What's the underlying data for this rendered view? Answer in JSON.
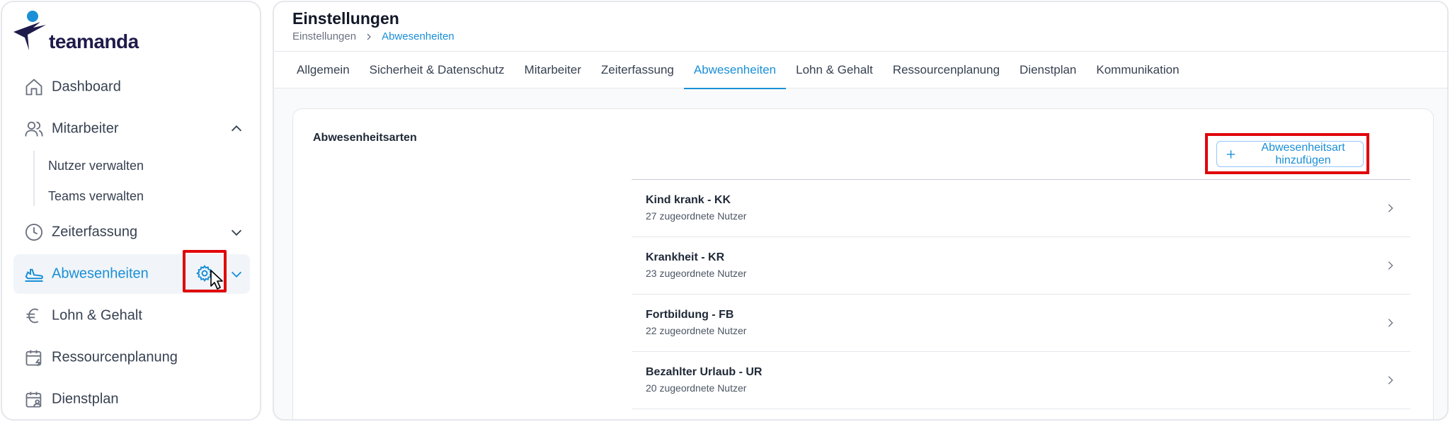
{
  "brand": {
    "name": "teamanda"
  },
  "sidebar": {
    "items": [
      {
        "label": "Dashboard",
        "icon": "home-icon"
      },
      {
        "label": "Mitarbeiter",
        "icon": "users-icon",
        "expanded": true
      },
      {
        "label": "Zeiterfassung",
        "icon": "clock-icon",
        "expanded": false
      },
      {
        "label": "Abwesenheiten",
        "icon": "plane-icon",
        "active": true
      },
      {
        "label": "Lohn & Gehalt",
        "icon": "euro-icon"
      },
      {
        "label": "Ressourcenplanung",
        "icon": "calendar-icon"
      },
      {
        "label": "Dienstplan",
        "icon": "calendar-user-icon"
      }
    ],
    "sub_items": [
      "Nutzer verwalten",
      "Teams verwalten"
    ]
  },
  "header": {
    "title": "Einstellungen",
    "breadcrumb": [
      "Einstellungen",
      "Abwesenheiten"
    ]
  },
  "tabs": [
    {
      "label": "Allgemein"
    },
    {
      "label": "Sicherheit & Datenschutz"
    },
    {
      "label": "Mitarbeiter"
    },
    {
      "label": "Zeiterfassung"
    },
    {
      "label": "Abwesenheiten",
      "active": true
    },
    {
      "label": "Lohn & Gehalt"
    },
    {
      "label": "Ressourcenplanung"
    },
    {
      "label": "Dienstplan"
    },
    {
      "label": "Kommunikation"
    }
  ],
  "card": {
    "title": "Abwesenheitsarten",
    "add_button_label": "Abwesenheitsart hinzufügen",
    "rows": [
      {
        "title": "Kind krank - KK",
        "subtitle": "27 zugeordnete Nutzer"
      },
      {
        "title": "Krankheit - KR",
        "subtitle": "23 zugeordnete Nutzer"
      },
      {
        "title": "Fortbildung - FB",
        "subtitle": "22 zugeordnete Nutzer"
      },
      {
        "title": "Bezahlter Urlaub - UR",
        "subtitle": "20 zugeordnete Nutzer"
      }
    ]
  },
  "colors": {
    "accent": "#1a8fd6",
    "highlight": "#e0040b",
    "active_bg": "#f1f5f9"
  }
}
